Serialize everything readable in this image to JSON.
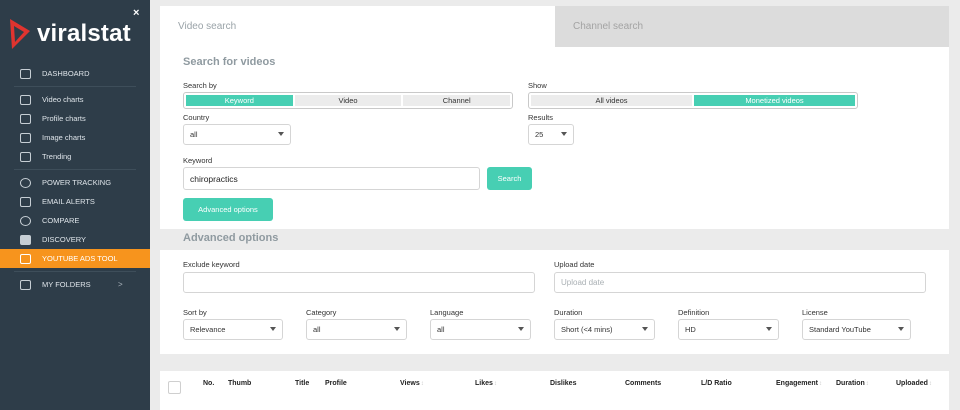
{
  "app": {
    "logo_text": "viralstat",
    "close_glyph": "×"
  },
  "sidebar": {
    "items": [
      {
        "label": "DASHBOARD",
        "icon": "dashboard-icon"
      },
      {
        "label": "Video charts",
        "icon": "video-charts-icon"
      },
      {
        "label": "Profile charts",
        "icon": "profile-charts-icon"
      },
      {
        "label": "Image charts",
        "icon": "image-charts-icon"
      },
      {
        "label": "Trending",
        "icon": "trending-icon"
      },
      {
        "label": "POWER TRACKING",
        "icon": "power-tracking-icon"
      },
      {
        "label": "EMAIL ALERTS",
        "icon": "envelope-icon"
      },
      {
        "label": "COMPARE",
        "icon": "compare-icon"
      },
      {
        "label": "DISCOVERY",
        "icon": "discovery-icon"
      },
      {
        "label": "YOUTUBE ADS TOOL",
        "icon": "film-icon",
        "active": true
      },
      {
        "label": "MY FOLDERS",
        "icon": "folder-icon",
        "chevron": ">"
      }
    ],
    "active_color": "#f7941d"
  },
  "tabs": [
    {
      "label": "Video search",
      "active": true
    },
    {
      "label": "Channel search",
      "active": false
    }
  ],
  "search": {
    "title": "Search for videos",
    "search_by_label": "Search by",
    "search_by_options": [
      "Keyword",
      "Video",
      "Channel"
    ],
    "search_by_selected": "Keyword",
    "show_label": "Show",
    "show_options": [
      "All videos",
      "Monetized videos"
    ],
    "show_selected": "Monetized videos",
    "country_label": "Country",
    "country_value": "all",
    "results_label": "Results",
    "results_value": "25",
    "keyword_label": "Keyword",
    "keyword_value": "chiropractics",
    "search_button": "Search",
    "advanced_button": "Advanced options"
  },
  "advanced": {
    "title": "Advanced options",
    "exclude_label": "Exclude keyword",
    "exclude_value": "",
    "upload_date_label": "Upload date",
    "upload_date_placeholder": "Upload date",
    "filters": [
      {
        "label": "Sort by",
        "value": "Relevance"
      },
      {
        "label": "Category",
        "value": "all"
      },
      {
        "label": "Language",
        "value": "all"
      },
      {
        "label": "Duration",
        "value": "Short (<4 mins)"
      },
      {
        "label": "Definition",
        "value": "HD"
      },
      {
        "label": "License",
        "value": "Standard YouTube"
      }
    ]
  },
  "table": {
    "columns": [
      "No.",
      "Thumb",
      "Title",
      "Profile",
      "Views",
      "Likes",
      "Dislikes",
      "Comments",
      "L/D Ratio",
      "Engagement",
      "Duration",
      "Uploaded"
    ],
    "sort_glyph": "↕"
  },
  "colors": {
    "accent": "#47cfb3",
    "sidebar_bg": "#2e3d49",
    "active_nav": "#f7941d"
  }
}
